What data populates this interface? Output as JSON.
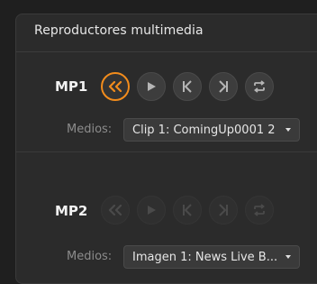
{
  "panel": {
    "title": "Reproductores multimedia"
  },
  "players": [
    {
      "name": "MP1",
      "media_label": "Medios:",
      "selected_media": "Clip 1: ComingUp0001 2",
      "buttons": [
        {
          "icon": "rewind-icon",
          "state": "active"
        },
        {
          "icon": "play-icon",
          "state": "normal"
        },
        {
          "icon": "previous-frame-icon",
          "state": "normal"
        },
        {
          "icon": "next-frame-icon",
          "state": "normal"
        },
        {
          "icon": "loop-icon",
          "state": "normal"
        }
      ]
    },
    {
      "name": "MP2",
      "media_label": "Medios:",
      "selected_media": "Imagen 1: News Live B...",
      "buttons": [
        {
          "icon": "rewind-icon",
          "state": "disabled"
        },
        {
          "icon": "play-icon",
          "state": "disabled"
        },
        {
          "icon": "previous-frame-icon",
          "state": "disabled"
        },
        {
          "icon": "next-frame-icon",
          "state": "disabled"
        },
        {
          "icon": "loop-icon",
          "state": "disabled"
        }
      ]
    }
  ],
  "colors": {
    "accent": "#f28c1c",
    "background": "#1f1f1f",
    "panel": "#2b2b2b",
    "button": "#3d3d3d"
  }
}
